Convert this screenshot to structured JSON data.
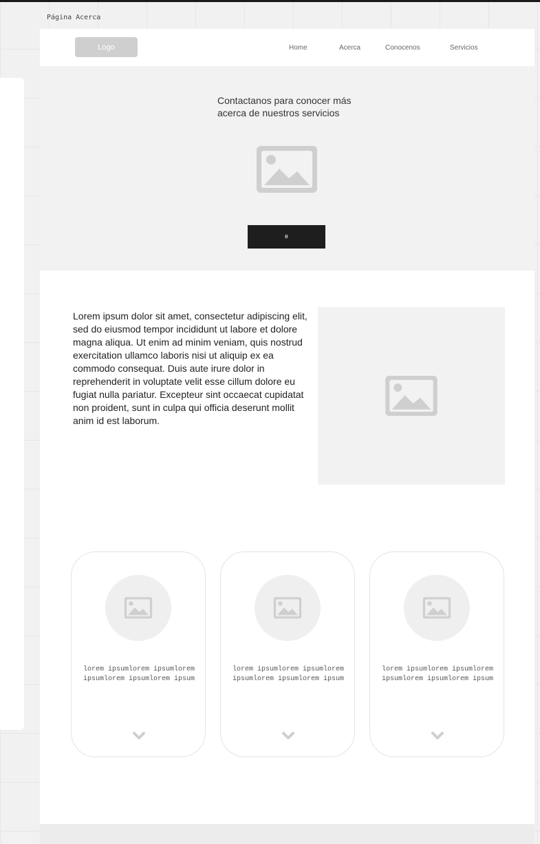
{
  "page_label": "Página Acerca",
  "header": {
    "logo": "Logo",
    "nav": [
      "Home",
      "Acerca",
      "Conocenos",
      "Servicios"
    ]
  },
  "hero": {
    "line1": "Contactanos para conocer más",
    "line2": "acerca de nuestros servicios",
    "image_icon": "image-placeholder-icon",
    "button_label": "B"
  },
  "content": {
    "paragraph": "Lorem ipsum dolor sit amet, consectetur adipiscing elit, sed do eiusmod tempor incididunt ut labore et dolore magna aliqua. Ut enim ad minim veniam, quis nostrud exercitation ullamco laboris nisi ut aliquip ex ea commodo consequat. Duis aute irure dolor in reprehenderit in voluptate velit esse cillum dolore eu fugiat nulla pariatur. Excepteur sint occaecat cupidatat non proident, sunt in culpa qui officia deserunt mollit anim id est laborum.",
    "image_icon": "image-placeholder-icon"
  },
  "cards": [
    {
      "text": "lorem ipsumlorem ipsumlorem ipsumlorem ipsumlorem ipsum",
      "icon": "image-placeholder-icon",
      "chevron": "chevron-down-icon"
    },
    {
      "text": "lorem ipsumlorem ipsumlorem ipsumlorem ipsumlorem ipsum",
      "icon": "image-placeholder-icon",
      "chevron": "chevron-down-icon"
    },
    {
      "text": "lorem ipsumlorem ipsumlorem ipsumlorem ipsumlorem ipsum",
      "icon": "image-placeholder-icon",
      "chevron": "chevron-down-icon"
    }
  ],
  "colors": {
    "placeholder": "#cfcfcf",
    "hero_bg": "#f2f2f2",
    "button_bg": "#1e1e1e",
    "canvas_bg": "#f1f1f1"
  }
}
